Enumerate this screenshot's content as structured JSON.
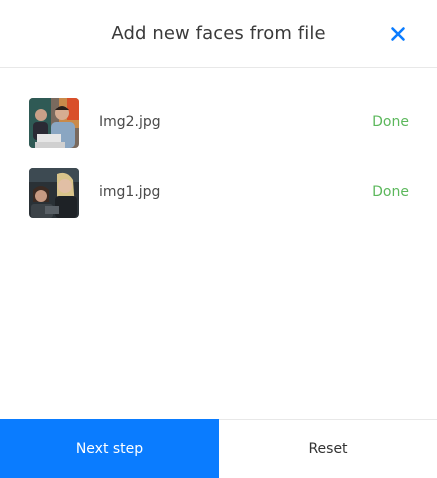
{
  "dialog": {
    "title": "Add new faces from file",
    "close_icon": "close-icon",
    "accent_color": "#0a7cff",
    "done_color": "#5cb85c"
  },
  "files": [
    {
      "name": "Img2.jpg",
      "status": "Done",
      "thumbnail": "photo-two-people-laptop"
    },
    {
      "name": "img1.jpg",
      "status": "Done",
      "thumbnail": "photo-two-women-dark"
    }
  ],
  "footer": {
    "next_label": "Next step",
    "reset_label": "Reset"
  }
}
